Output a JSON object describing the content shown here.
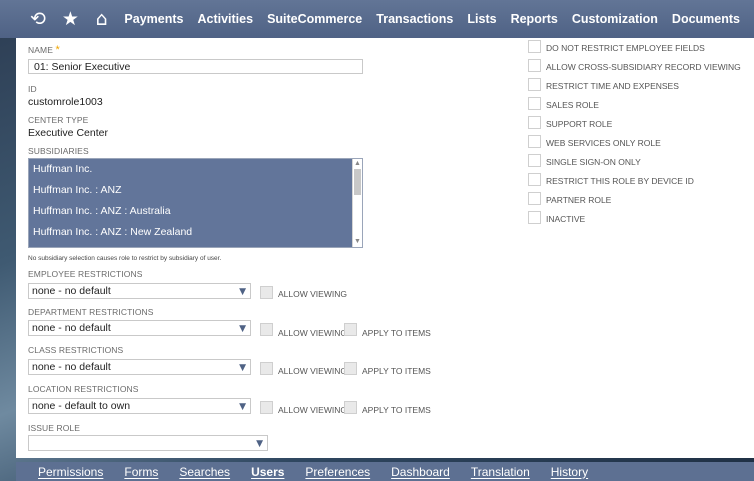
{
  "topnav": {
    "icons": [
      "recent-records-icon",
      "star-icon",
      "home-icon"
    ],
    "items": [
      "Payments",
      "Activities",
      "SuiteCommerce",
      "Transactions",
      "Lists",
      "Reports",
      "Customization",
      "Documents"
    ]
  },
  "form": {
    "name_label": "NAME",
    "name_required": "*",
    "name_value": "01: Senior Executive",
    "id_label": "ID",
    "id_value": "customrole1003",
    "center_type_label": "CENTER TYPE",
    "center_type_value": "Executive Center",
    "subsidiaries_label": "SUBSIDIARIES",
    "subsidiaries": [
      "Huffman Inc.",
      "Huffman Inc. : ANZ",
      "Huffman Inc. : ANZ : Australia",
      "Huffman Inc. : ANZ : New Zealand"
    ],
    "subsidiaries_note": "No subsidiary selection causes role to restrict by subsidiary of user.",
    "employee_restrictions_label": "EMPLOYEE RESTRICTIONS",
    "employee_restrictions_value": "none - no default",
    "department_restrictions_label": "DEPARTMENT RESTRICTIONS",
    "department_restrictions_value": "none - no default",
    "class_restrictions_label": "CLASS RESTRICTIONS",
    "class_restrictions_value": "none - no default",
    "location_restrictions_label": "LOCATION RESTRICTIONS",
    "location_restrictions_value": "none - default to own",
    "issue_role_label": "ISSUE ROLE",
    "issue_role_value": "",
    "allow_viewing": "ALLOW VIEWING",
    "apply_to_items": "APPLY TO ITEMS"
  },
  "checkboxes": [
    "DO NOT RESTRICT EMPLOYEE FIELDS",
    "ALLOW CROSS-SUBSIDIARY RECORD VIEWING",
    "RESTRICT TIME AND EXPENSES",
    "SALES ROLE",
    "SUPPORT ROLE",
    "WEB SERVICES ONLY ROLE",
    "SINGLE SIGN-ON ONLY",
    "RESTRICT THIS ROLE BY DEVICE ID",
    "PARTNER ROLE",
    "INACTIVE"
  ],
  "tabs": [
    {
      "label": "Permissions",
      "active": false
    },
    {
      "label": "Forms",
      "active": false
    },
    {
      "label": "Searches",
      "active": false
    },
    {
      "label": "Users",
      "active": true
    },
    {
      "label": "Preferences",
      "active": false
    },
    {
      "label": "Dashboard",
      "active": false
    },
    {
      "label": "Translation",
      "active": false
    },
    {
      "label": "History",
      "active": false
    }
  ],
  "colors": {
    "nav_bg": "#5a6b8c",
    "selected_bg": "#62759a",
    "required": "#f0a500"
  }
}
